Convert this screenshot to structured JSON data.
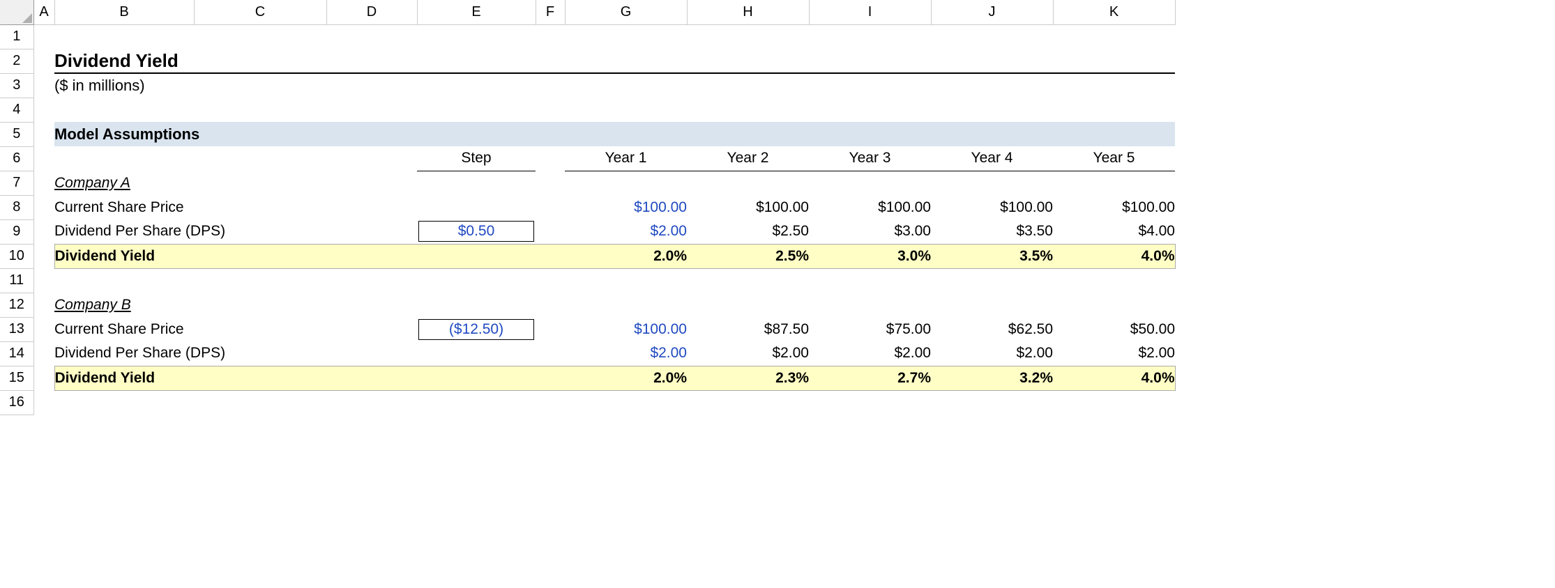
{
  "columns": [
    "A",
    "B",
    "C",
    "D",
    "E",
    "F",
    "G",
    "H",
    "I",
    "J",
    "K"
  ],
  "row_count": 16,
  "title": "Dividend Yield",
  "subtitle": "($ in millions)",
  "section_header": "Model Assumptions",
  "step_label": "Step",
  "years": [
    "Year 1",
    "Year 2",
    "Year 3",
    "Year 4",
    "Year 5"
  ],
  "companyA": {
    "name": "Company A",
    "rows": {
      "share_price": {
        "label": "Current Share Price",
        "step": "",
        "values": [
          "$100.00",
          "$100.00",
          "$100.00",
          "$100.00",
          "$100.00"
        ],
        "blue_first": true
      },
      "dps": {
        "label": "Dividend Per Share (DPS)",
        "step": "$0.50",
        "values": [
          "$2.00",
          "$2.50",
          "$3.00",
          "$3.50",
          "$4.00"
        ],
        "blue_first": true,
        "step_boxed": true
      },
      "yield": {
        "label": "Dividend Yield",
        "values": [
          "2.0%",
          "2.5%",
          "3.0%",
          "3.5%",
          "4.0%"
        ]
      }
    }
  },
  "companyB": {
    "name": "Company B",
    "rows": {
      "share_price": {
        "label": "Current Share Price",
        "step": "($12.50)",
        "values": [
          "$100.00",
          "$87.50",
          "$75.00",
          "$62.50",
          "$50.00"
        ],
        "blue_first": true,
        "step_boxed": true
      },
      "dps": {
        "label": "Dividend Per Share (DPS)",
        "step": "",
        "values": [
          "$2.00",
          "$2.00",
          "$2.00",
          "$2.00",
          "$2.00"
        ],
        "blue_first": true
      },
      "yield": {
        "label": "Dividend Yield",
        "values": [
          "2.0%",
          "2.3%",
          "2.7%",
          "3.2%",
          "4.0%"
        ]
      }
    }
  }
}
